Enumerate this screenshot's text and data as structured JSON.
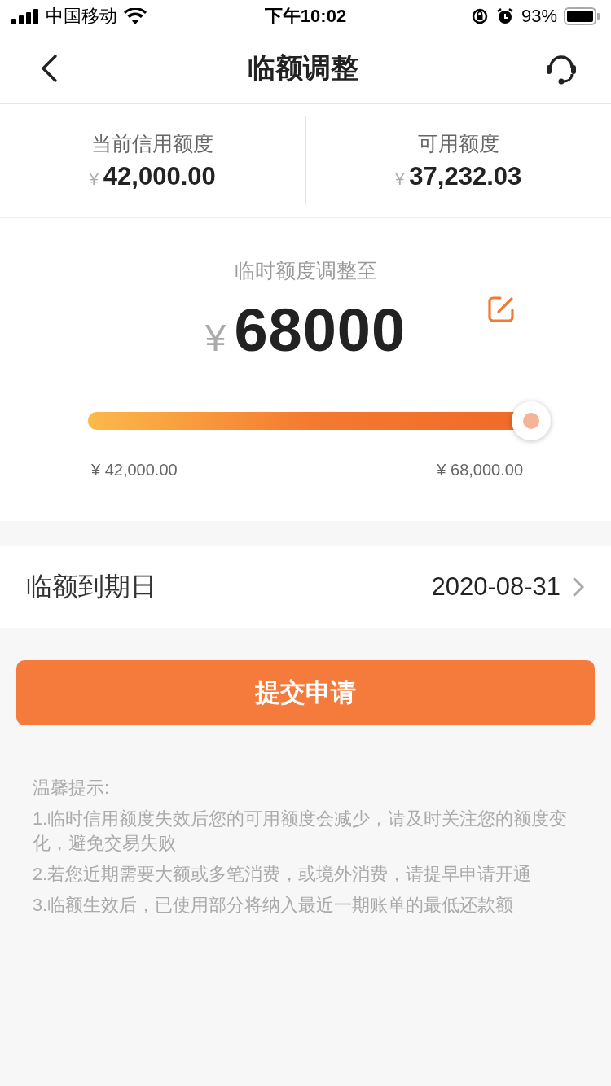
{
  "status_bar": {
    "carrier": "中国移动",
    "time": "下午10:02",
    "battery": "93%"
  },
  "nav": {
    "title": "临额调整"
  },
  "summary": [
    {
      "label": "当前信用额度",
      "currency": "¥",
      "amount": "42,000.00"
    },
    {
      "label": "可用额度",
      "currency": "¥",
      "amount": "37,232.03"
    }
  ],
  "adjust": {
    "label": "临时额度调整至",
    "currency": "¥",
    "amount": "68000",
    "slider": {
      "level": 1.0,
      "min_label": "¥ 42,000.00",
      "max_label": "¥ 68,000.00"
    }
  },
  "expiry": {
    "label": "临额到期日",
    "value": "2020-08-31"
  },
  "submit": {
    "label": "提交申请"
  },
  "tips": {
    "title": "温馨提示:",
    "items": [
      "1.临时信用额度失效后您的可用额度会减少，请及时关注您的额度变化，避免交易失败",
      "2.若您近期需要大额或多笔消费，或境外消费，请提早申请开通",
      "3.临额生效后，已使用部分将纳入最近一期账单的最低还款额"
    ]
  }
}
